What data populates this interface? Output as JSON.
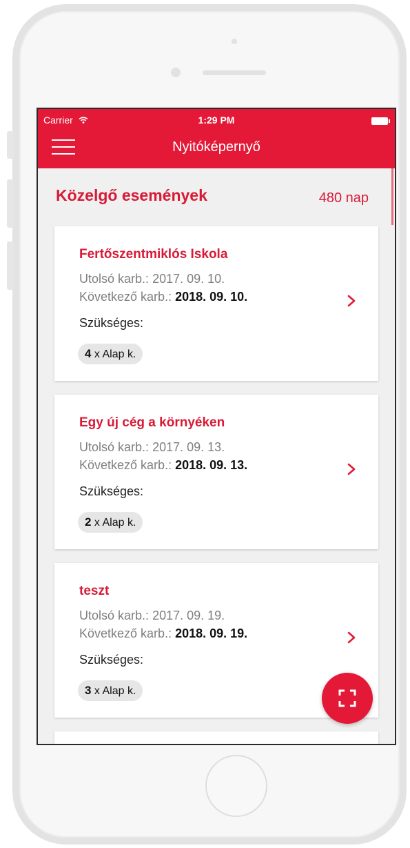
{
  "status_bar": {
    "carrier": "Carrier",
    "time": "1:29 PM"
  },
  "nav": {
    "title": "Nyitóképernyő"
  },
  "section": {
    "title": "Közelgő események",
    "count": "480 nap"
  },
  "cards": [
    {
      "title": "Fertőszentmiklós Iskola",
      "last_label": "Utolsó karb.:",
      "last_value": "2017. 09. 10.",
      "next_label": "Következő karb.:",
      "next_value": "2018. 09. 10.",
      "need_label": "Szükséges:",
      "qty": "4",
      "qty_label": "x Alap k."
    },
    {
      "title": "Egy új cég a környéken",
      "last_label": "Utolsó karb.:",
      "last_value": "2017. 09. 13.",
      "next_label": "Következő karb.:",
      "next_value": "2018. 09. 13.",
      "need_label": "Szükséges:",
      "qty": "2",
      "qty_label": "x Alap k."
    },
    {
      "title": "teszt",
      "last_label": "Utolsó karb.:",
      "last_value": "2017. 09. 19.",
      "next_label": "Következő karb.:",
      "next_value": "2018. 09. 19.",
      "need_label": "Szükséges:",
      "qty": "3",
      "qty_label": "x Alap k."
    }
  ],
  "icons": {
    "menu": "hamburger-menu-icon",
    "chevron": "chevron-right-icon",
    "fab": "scan-frame-icon",
    "wifi": "wifi-icon",
    "battery": "battery-icon"
  },
  "colors": {
    "accent": "#e31937",
    "title_red": "#d81a36",
    "background": "#f0f0f0"
  }
}
